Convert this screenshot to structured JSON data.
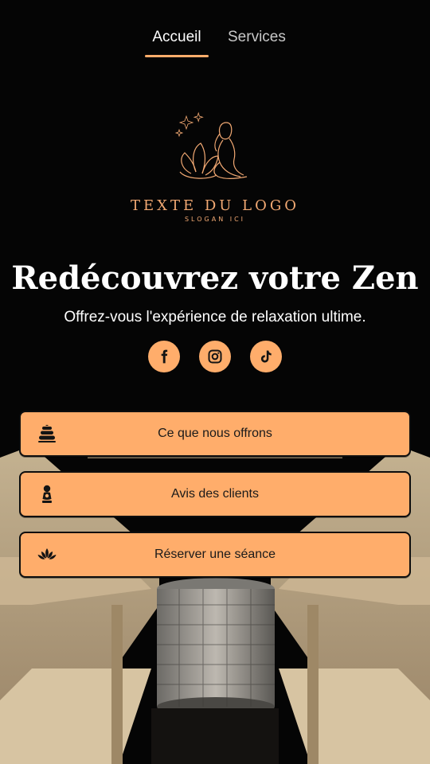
{
  "nav": {
    "tabs": [
      {
        "label": "Accueil",
        "active": true
      },
      {
        "label": "Services",
        "active": false
      }
    ]
  },
  "logo": {
    "text": "TEXTE DU LOGO",
    "slogan": "SLOGAN ICI",
    "icon": "lotus-woman-emblem"
  },
  "hero": {
    "title": "Redécouvrez votre Zen",
    "subtitle": "Offrez-vous l'expérience de relaxation ultime."
  },
  "socials": [
    {
      "network": "facebook",
      "icon": "facebook-icon"
    },
    {
      "network": "instagram",
      "icon": "instagram-icon"
    },
    {
      "network": "tiktok",
      "icon": "tiktok-icon"
    }
  ],
  "actions": [
    {
      "label": "Ce que nous offrons",
      "icon": "stacked-stones-icon"
    },
    {
      "label": "Avis des clients",
      "icon": "person-bust-icon"
    },
    {
      "label": "Réserver une séance",
      "icon": "lotus-icon"
    }
  ],
  "colors": {
    "accent": "#ffad6b",
    "logo": "#f2a973",
    "background": "#050505"
  }
}
